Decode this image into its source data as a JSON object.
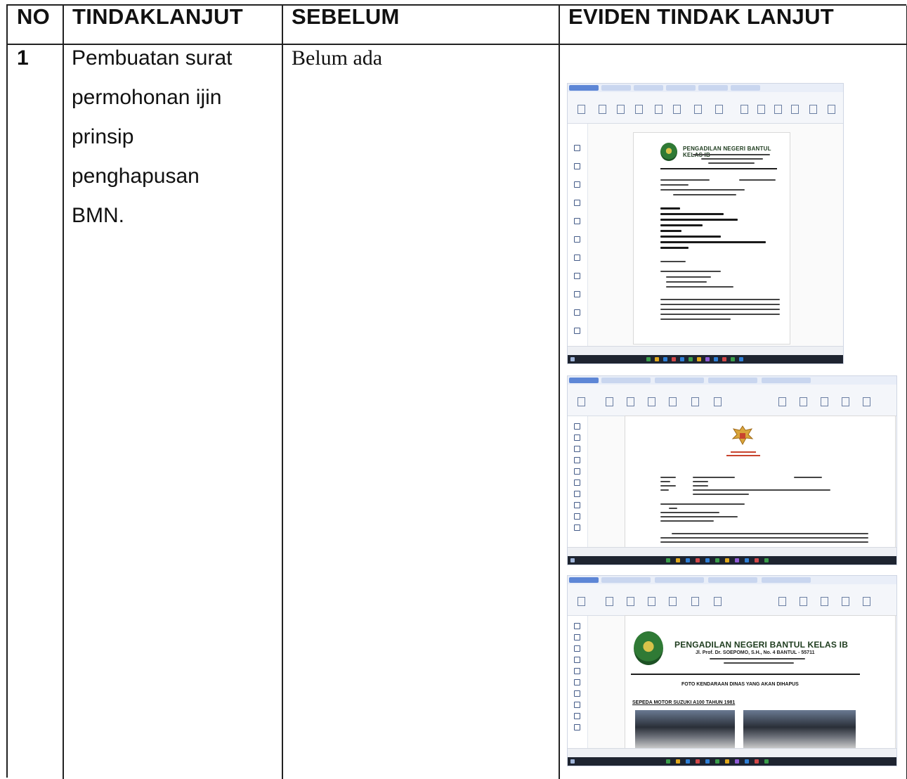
{
  "table": {
    "headers": {
      "no": "NO",
      "tindaklanjut": "TINDAKLANJUT",
      "sebelum": "SEBELUM",
      "eviden": "EVIDEN TINDAK LANJUT"
    },
    "rows": [
      {
        "no": "1",
        "tindaklanjut_lines": [
          "Pembuatan surat",
          "permohonan ijin",
          "prinsip",
          "penghapusan",
          "BMN."
        ],
        "sebelum": "Belum ada"
      }
    ]
  },
  "evidence": {
    "shot1": {
      "letterhead": "PENGADILAN NEGERI BANTUL KELAS IB"
    },
    "shot3": {
      "letterhead": "PENGADILAN NEGERI BANTUL KELAS IB",
      "address": "Jl. Prof. Dr. SOEPOMO, S.H., No. 4 BANTUL - 55711",
      "heading": "FOTO KENDARAAN DINAS YANG AKAN DIHAPUS",
      "vehicle": "SEPEDA MOTOR SUZUKI A100 TAHUN 1981"
    }
  },
  "colors": {
    "border": "#222222",
    "accent_tab": "#5d86d6",
    "logo_green": "#2f7a35"
  }
}
